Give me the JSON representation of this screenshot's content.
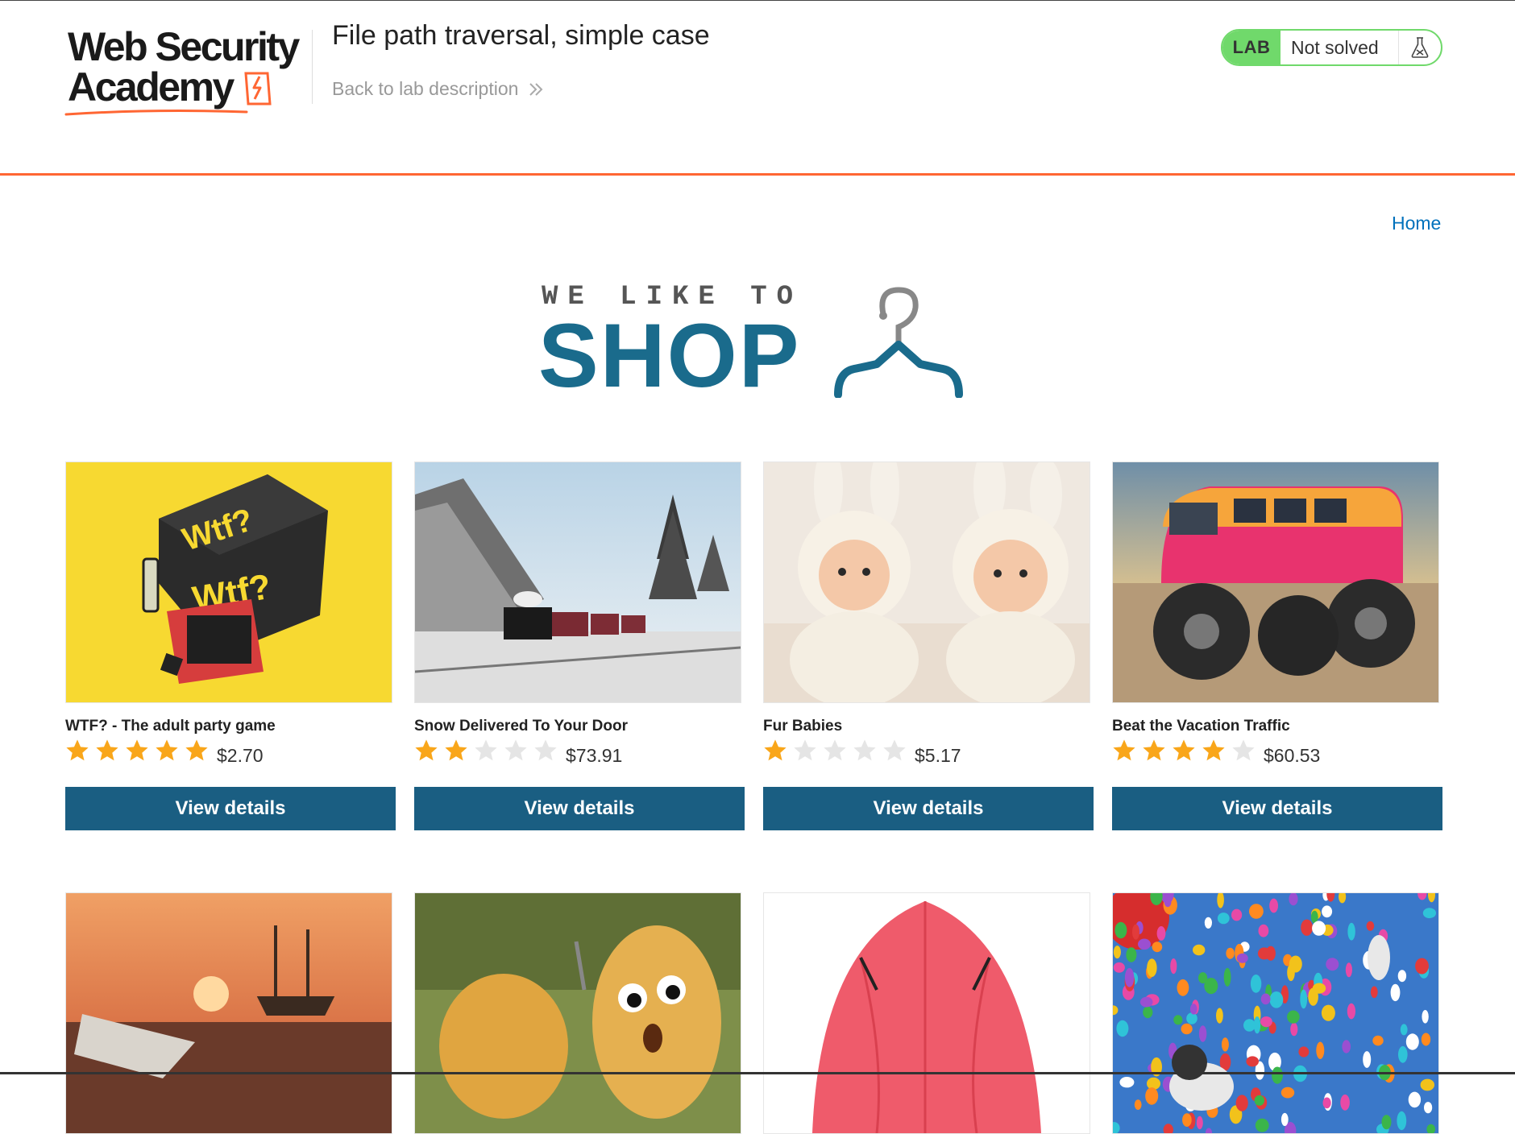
{
  "academy": {
    "logo_line1": "Web Security",
    "logo_line2": "Academy",
    "lab_title": "File path traversal, simple case",
    "back_link": "Back to lab description",
    "lab_badge": "LAB",
    "lab_status": "Not solved",
    "accent_color": "#ff6633",
    "lab_status_color": "#70d96b"
  },
  "nav": {
    "home": "Home"
  },
  "banner": {
    "small": "WE LIKE TO",
    "big": "SHOP"
  },
  "colors": {
    "brand_blue": "#1a5e82",
    "link_blue": "#0071bc",
    "star": "#f9a61a",
    "star_empty": "#e5e5e5"
  },
  "products": [
    {
      "name": "WTF? - The adult party game",
      "rating": 5,
      "price": "$2.70",
      "button": "View details",
      "icon": "party-game-image"
    },
    {
      "name": "Snow Delivered To Your Door",
      "rating": 2,
      "price": "$73.91",
      "button": "View details",
      "icon": "snowy-train-image"
    },
    {
      "name": "Fur Babies",
      "rating": 1,
      "price": "$5.17",
      "button": "View details",
      "icon": "babies-in-bunny-suits-image"
    },
    {
      "name": "Beat the Vacation Traffic",
      "rating": 4,
      "price": "$60.53",
      "button": "View details",
      "icon": "monster-van-image"
    },
    {
      "icon": "paper-boat-sunset-image"
    },
    {
      "icon": "potato-faces-image"
    },
    {
      "icon": "red-umbrella-image"
    },
    {
      "icon": "balloons-dog-image"
    }
  ]
}
